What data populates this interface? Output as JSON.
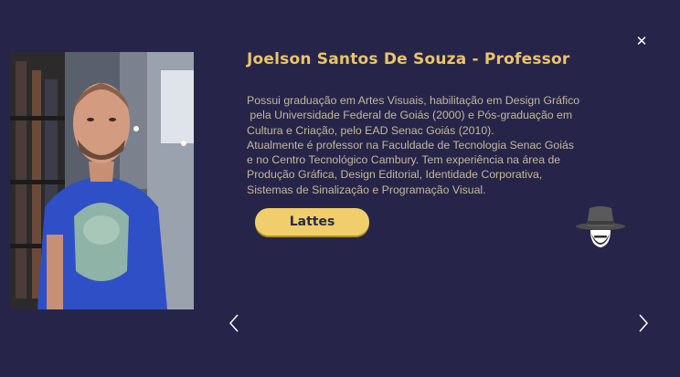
{
  "modal": {
    "close_icon": "close-icon",
    "title": "Joelson Santos De Souza - Professor",
    "bio_lines": [
      "Possui graduação em Artes Visuais, habilitação em Design Gráfico",
      " pela Universidade Federal de Goiás (2000) e Pós-graduação em",
      "Cultura e Criação, pelo EAD Senac Goiás (2010).",
      "Atualmente é professor na Faculdade de Tecnologia Senac Goiás",
      "e no Centro Tecnológico Cambury. Tem experiência na área de",
      "Produção Gráfica, Design Editorial, Identidade Corporativa,",
      "Sistemas de Sinalização e Programação Visual."
    ],
    "lattes_label": "Lattes",
    "prev_icon": "chevron-left-icon",
    "next_icon": "chevron-right-icon",
    "avatar_icon": "detective-hat-icon"
  },
  "colors": {
    "background": "#262549",
    "title": "#e9c46a",
    "body_text": "#c4b89a",
    "button": "#f0ce6c",
    "button_text": "#2a2a46"
  }
}
